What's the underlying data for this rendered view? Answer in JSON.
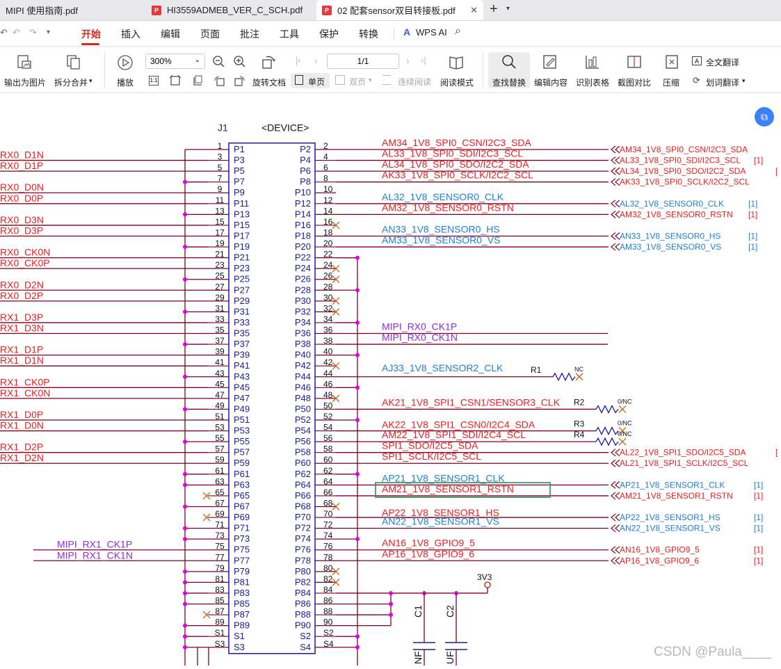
{
  "tabs": [
    {
      "label": "MIPI 使用指南.pdf",
      "active": false
    },
    {
      "label": "HI3559ADMEB_VER_C_SCH.pdf",
      "active": false
    },
    {
      "label": "02 配套sensor双目转接板.pdf",
      "active": true
    }
  ],
  "menu": [
    "开始",
    "插入",
    "编辑",
    "页面",
    "批注",
    "工具",
    "保护",
    "转换"
  ],
  "wps_ai": "WPS AI",
  "toolbar": {
    "export_image": "输出为图片",
    "split_merge": "拆分合并",
    "play": "播放",
    "zoom": "300%",
    "rotate": "旋转文档",
    "single": "单页",
    "double": "双页",
    "continuous": "连续阅读",
    "page": "1/1",
    "read_mode": "阅读模式",
    "find_replace": "查找替换",
    "edit_content": "编辑内容",
    "recognize_table": "识别表格",
    "screenshot_compare": "截图对比",
    "compress": "压缩",
    "full_translate": "全文翻译",
    "word_translate": "划词翻译"
  },
  "schematic": {
    "ref": "J1",
    "device": "<DEVICE>",
    "left_pins": [
      "P1",
      "P3",
      "P5",
      "P7",
      "P9",
      "P11",
      "P13",
      "P15",
      "P17",
      "P19",
      "P21",
      "P23",
      "P25",
      "P27",
      "P29",
      "P31",
      "P33",
      "P35",
      "P37",
      "P39",
      "P41",
      "P43",
      "P45",
      "P47",
      "P49",
      "P51",
      "P53",
      "P55",
      "P57",
      "P59",
      "P61",
      "P63",
      "P65",
      "P67",
      "P69",
      "P71",
      "P73",
      "P75",
      "P77",
      "P79",
      "P81",
      "P83",
      "P85",
      "P87",
      "P89",
      "S1",
      "S3"
    ],
    "left_nums": [
      "1",
      "3",
      "5",
      "7",
      "9",
      "11",
      "13",
      "15",
      "17",
      "19",
      "21",
      "23",
      "25",
      "27",
      "29",
      "31",
      "33",
      "35",
      "37",
      "39",
      "41",
      "43",
      "45",
      "47",
      "49",
      "51",
      "53",
      "55",
      "57",
      "59",
      "61",
      "63",
      "65",
      "67",
      "69",
      "71",
      "73",
      "75",
      "77",
      "79",
      "81",
      "83",
      "85",
      "87",
      "89",
      "S1",
      "S3"
    ],
    "right_pins": [
      "P2",
      "P4",
      "P6",
      "P8",
      "P10",
      "P12",
      "P14",
      "P16",
      "P18",
      "P20",
      "P22",
      "P24",
      "P26",
      "P28",
      "P30",
      "P32",
      "P34",
      "P36",
      "P38",
      "P40",
      "P42",
      "P44",
      "P46",
      "P48",
      "P50",
      "P52",
      "P54",
      "P56",
      "P58",
      "P60",
      "P62",
      "P64",
      "P66",
      "P68",
      "P70",
      "P72",
      "P74",
      "P76",
      "P78",
      "P80",
      "P82",
      "P84",
      "P86",
      "P88",
      "P90",
      "S2",
      "S4"
    ],
    "right_nums": [
      "2",
      "4",
      "6",
      "8",
      "10",
      "12",
      "14",
      "16",
      "18",
      "20",
      "22",
      "24",
      "26",
      "28",
      "30",
      "32",
      "34",
      "36",
      "38",
      "40",
      "42",
      "44",
      "46",
      "48",
      "50",
      "52",
      "54",
      "56",
      "58",
      "60",
      "62",
      "64",
      "66",
      "68",
      "70",
      "72",
      "74",
      "76",
      "78",
      "80",
      "82",
      "84",
      "86",
      "88",
      "90",
      "S2",
      "S4"
    ],
    "left_nets": [
      {
        "row": 1,
        "text": "RX0_D1N"
      },
      {
        "row": 2,
        "text": "RX0_D1P"
      },
      {
        "row": 4,
        "text": "RX0_D0N"
      },
      {
        "row": 5,
        "text": "RX0_D0P"
      },
      {
        "row": 7,
        "text": "RX0_D3N"
      },
      {
        "row": 8,
        "text": "RX0_D3P"
      },
      {
        "row": 10,
        "text": "RX0_CK0N"
      },
      {
        "row": 11,
        "text": "RX0_CK0P"
      },
      {
        "row": 13,
        "text": "RX0_D2N"
      },
      {
        "row": 14,
        "text": "RX0_D2P"
      },
      {
        "row": 16,
        "text": "RX1_D3P"
      },
      {
        "row": 17,
        "text": "RX1_D3N"
      },
      {
        "row": 19,
        "text": "RX1_D1P"
      },
      {
        "row": 20,
        "text": "RX1_D1N"
      },
      {
        "row": 22,
        "text": "RX1_CK0P"
      },
      {
        "row": 23,
        "text": "RX1_CK0N"
      },
      {
        "row": 25,
        "text": "RX1_D0P"
      },
      {
        "row": 26,
        "text": "RX1_D0N"
      },
      {
        "row": 28,
        "text": "RX1_D2P"
      },
      {
        "row": 29,
        "text": "RX1_D2N"
      }
    ],
    "mipi_rx1": [
      {
        "row": 37,
        "text": "MIPI_RX1_CK1P"
      },
      {
        "row": 38,
        "text": "MIPI_RX1_CK1N"
      }
    ],
    "right_nets": [
      {
        "row": 0,
        "text": "AM34_1V8_SPI0_CSN/I2C3_SDA",
        "color": "#ee1c1c",
        "off": 0
      },
      {
        "row": 1,
        "text": "AL33_1V8_SPI0_SDI/I2C3_SCL",
        "color": "#ee1c1c",
        "off": 0
      },
      {
        "row": 2,
        "text": "AL34_1V8_SPI0_SDO/I2C2_SDA",
        "color": "#ee1c1c",
        "off": 0
      },
      {
        "row": 3,
        "text": "AK33_1V8_SPI0_SCLK/I2C2_SCL",
        "color": "#ee1c1c",
        "off": 0
      },
      {
        "row": 5,
        "text": "AL32_1V8_SENSOR0_CLK",
        "color": "#1d7fd8",
        "off": 0
      },
      {
        "row": 6,
        "text": "AM32_1V8_SENSOR0_RSTN",
        "color": "#ee1c1c",
        "off": 0
      },
      {
        "row": 8,
        "text": "AN33_1V8_SENSOR0_HS",
        "color": "#1d7fd8",
        "off": 0
      },
      {
        "row": 9,
        "text": "AM33_1V8_SENSOR0_VS",
        "color": "#1d7fd8",
        "off": 0
      },
      {
        "row": 17,
        "text": "MIPI_RX0_CK1P",
        "color": "#8a2be2",
        "off": 0
      },
      {
        "row": 18,
        "text": "MIPI_RX0_CK1N",
        "color": "#8a2be2",
        "off": 0
      },
      {
        "row": 21,
        "text": "AJ33_1V8_SENSOR2_CLK",
        "color": "#1d7fd8",
        "off": -3
      },
      {
        "row": 24,
        "text": "AK21_1V8_SPI1_CSN1/SENSOR3_CLK",
        "color": "#ee1c1c",
        "off": 0
      },
      {
        "row": 26,
        "text": "AK22_1V8_SPI1_CSN0/I2C4_SDA",
        "color": "#ee1c1c",
        "off": 1
      },
      {
        "row": 27,
        "text": "AM22_1V8_SPI1_SDI/I2C4_SCL",
        "color": "#ee1c1c",
        "off": 0
      },
      {
        "row": 28,
        "text": "SPI1_SDO/I2C5_SDA",
        "color": "#ee1c1c",
        "off": 0
      },
      {
        "row": 29,
        "text": "SPI1_SCLK/I2C5_SCL",
        "color": "#ee1c1c",
        "off": 0
      },
      {
        "row": 31,
        "text": "AP21_1V8_SENSOR1_CLK",
        "color": "#1d7fd8",
        "off": 0
      },
      {
        "row": 32,
        "text": "AM21_1V8_SENSOR1_RSTN",
        "color": "#ee1c1c",
        "off": 0
      },
      {
        "row": 34,
        "text": "AP22_1V8_SENSOR1_HS",
        "color": "#ee1c1c",
        "off": 3
      },
      {
        "row": 35,
        "text": "AN22_1V8_SENSOR1_VS",
        "color": "#1d7fd8",
        "off": 0
      },
      {
        "row": 37,
        "text": "AN16_1V8_GPIO9_5",
        "color": "#ee1c1c",
        "off": 0
      },
      {
        "row": 38,
        "text": "AP16_1V8_GPIO9_6",
        "color": "#ee1c1c",
        "off": 0
      }
    ],
    "offpage": [
      {
        "row": 0,
        "text": "AM34_1V8_SPI0_CSN/I2C3_SDA",
        "color": "#ee1c1c",
        "ref": ""
      },
      {
        "row": 1,
        "text": "AL33_1V8_SPI0_SDI/I2C3_SCL",
        "color": "#ee1c1c",
        "ref": "[1]"
      },
      {
        "row": 2,
        "text": "AL34_1V8_SPI0_SDO/I2C2_SDA",
        "color": "#ee1c1c",
        "ref": "["
      },
      {
        "row": 3,
        "text": "AK33_1V8_SPI0_SCLK/I2C2_SCL",
        "color": "#ee1c1c",
        "ref": ""
      },
      {
        "row": 5,
        "text": "AL32_1V8_SENSOR0_CLK",
        "color": "#1d7fd8",
        "ref": "[1]"
      },
      {
        "row": 6,
        "text": "AM32_1V8_SENSOR0_RSTN",
        "color": "#ee1c1c",
        "ref": "[1]"
      },
      {
        "row": 8,
        "text": "AN33_1V8_SENSOR0_HS",
        "color": "#1d7fd8",
        "ref": "[1]"
      },
      {
        "row": 9,
        "text": "AM33_1V8_SENSOR0_VS",
        "color": "#1d7fd8",
        "ref": "[1]"
      },
      {
        "row": 28,
        "text": "AL22_1V8_SPI1_SDO/I2C5_SDA",
        "color": "#ee1c1c",
        "ref": "["
      },
      {
        "row": 29,
        "text": "AL21_1V8_SPI1_SCLK/I2C5_SCL",
        "color": "#ee1c1c",
        "ref": ""
      },
      {
        "row": 31,
        "text": "AP21_1V8_SENSOR1_CLK",
        "color": "#1d7fd8",
        "ref": "[1]"
      },
      {
        "row": 32,
        "text": "AM21_1V8_SENSOR1_RSTN",
        "color": "#ee1c1c",
        "ref": "[1]"
      },
      {
        "row": 34,
        "text": "AP22_1V8_SENSOR1_HS",
        "color": "#1d7fd8",
        "ref": "[1]"
      },
      {
        "row": 35,
        "text": "AN22_1V8_SENSOR1_VS",
        "color": "#1d7fd8",
        "ref": "[1]"
      },
      {
        "row": 37,
        "text": "AN16_1V8_GPIO9_5",
        "color": "#ee1c1c",
        "ref": "[1]"
      },
      {
        "row": 38,
        "text": "AP16_1V8_GPIO9_6",
        "color": "#ee1c1c",
        "ref": "[1]"
      }
    ],
    "nc_right_rows": [
      7,
      11,
      12,
      14,
      15,
      20,
      23,
      33,
      39,
      40
    ],
    "nc_left_rows": [
      32,
      34,
      43
    ],
    "gnd_right_rows": [
      10,
      13,
      16,
      19,
      22,
      25,
      30,
      36,
      45,
      46
    ],
    "gnd_left_rows": [
      3,
      6,
      9,
      12,
      15,
      18,
      21,
      24,
      27,
      30,
      31,
      33,
      35,
      36,
      39,
      40,
      41,
      42,
      44,
      45,
      46
    ],
    "resistors": [
      {
        "ref": "R1",
        "val": "NC",
        "row": 21
      },
      {
        "ref": "R2",
        "val": "0/NC",
        "row": 24
      },
      {
        "ref": "R3",
        "val": "0/NC",
        "row": 26
      },
      {
        "ref": "R4",
        "val": "0/NC",
        "row": 27
      }
    ],
    "power": "3V3",
    "caps": [
      {
        "ref": "C1",
        "val": "NF"
      },
      {
        "ref": "C2",
        "val": "UF"
      }
    ]
  },
  "watermark": "CSDN @Paula____"
}
